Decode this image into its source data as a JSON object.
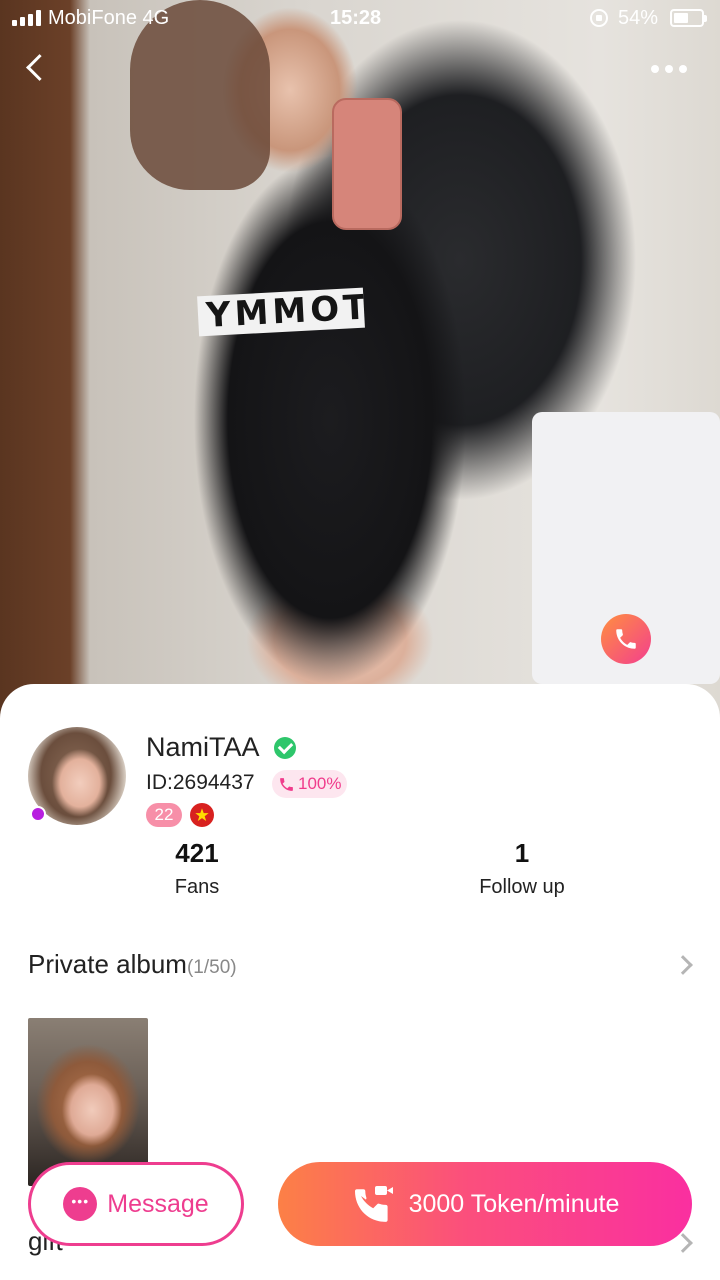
{
  "status_bar": {
    "carrier": "MobiFone  4G",
    "time": "15:28",
    "battery_pct": "54%",
    "battery_level": 0.54
  },
  "hero": {
    "shirt_text": "YMMOT"
  },
  "profile": {
    "name": "NamiTAA",
    "user_id": "ID:2694437",
    "answer_rate": "100%",
    "age": "22",
    "online_dot_color": "#b81fe0"
  },
  "stats": [
    {
      "value": "421",
      "label": "Fans"
    },
    {
      "value": "1",
      "label": "Follow up"
    }
  ],
  "album": {
    "title": "Private album",
    "count": "(1/50)"
  },
  "gift": {
    "label": "gift"
  },
  "actions": {
    "message_label": "Message",
    "call_label": "3000 Token/minute"
  },
  "colors": {
    "accent_pink": "#ee3d8f",
    "gradient_start": "#fc8046",
    "gradient_end": "#fa2fa0",
    "verified_green": "#2ec66b"
  }
}
